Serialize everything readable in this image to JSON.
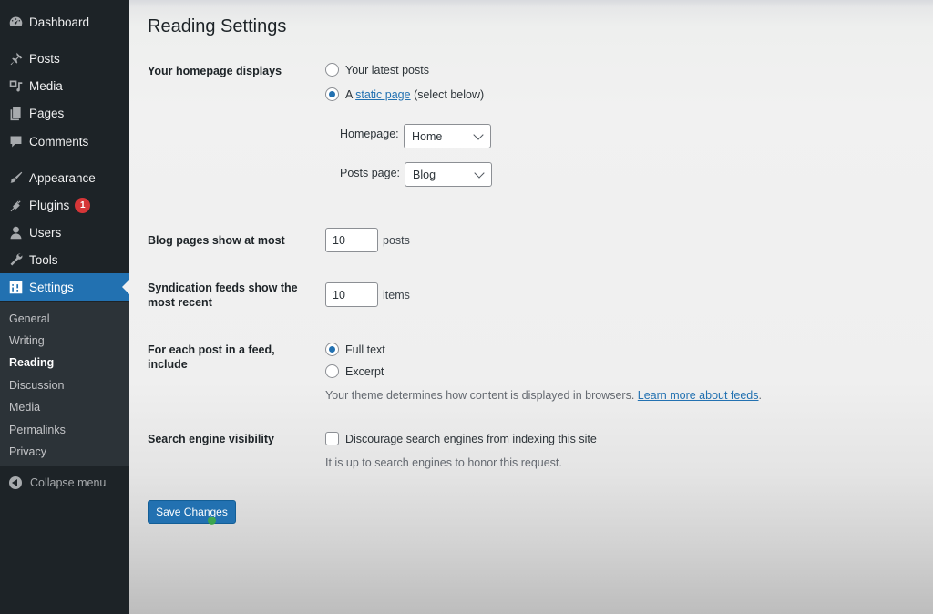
{
  "sidebar": {
    "items": [
      {
        "label": "Dashboard",
        "icon": "dashboard-icon"
      },
      {
        "label": "Posts",
        "icon": "pin-icon"
      },
      {
        "label": "Media",
        "icon": "media-icon"
      },
      {
        "label": "Pages",
        "icon": "pages-icon"
      },
      {
        "label": "Comments",
        "icon": "comment-icon"
      },
      {
        "label": "Appearance",
        "icon": "brush-icon"
      },
      {
        "label": "Plugins",
        "icon": "plugin-icon",
        "badge": "1"
      },
      {
        "label": "Users",
        "icon": "user-icon"
      },
      {
        "label": "Tools",
        "icon": "wrench-icon"
      },
      {
        "label": "Settings",
        "icon": "settings-icon",
        "active": true
      }
    ],
    "submenu": [
      {
        "label": "General"
      },
      {
        "label": "Writing"
      },
      {
        "label": "Reading",
        "current": true
      },
      {
        "label": "Discussion"
      },
      {
        "label": "Media"
      },
      {
        "label": "Permalinks"
      },
      {
        "label": "Privacy"
      }
    ],
    "collapse_label": "Collapse menu"
  },
  "page": {
    "title": "Reading Settings",
    "homepage_displays": {
      "label": "Your homepage displays",
      "options": [
        {
          "label": "Your latest posts",
          "checked": false
        },
        {
          "prefix": "A ",
          "link": "static page",
          "suffix": " (select below)",
          "checked": true
        }
      ],
      "homepage_select": {
        "label": "Homepage:",
        "value": "Home"
      },
      "posts_page_select": {
        "label": "Posts page:",
        "value": "Blog"
      }
    },
    "blog_pages": {
      "label": "Blog pages show at most",
      "value": "10",
      "unit": "posts"
    },
    "syndication": {
      "label": "Syndication feeds show the most recent",
      "value": "10",
      "unit": "items"
    },
    "feed_include": {
      "label": "For each post in a feed, include",
      "options": [
        {
          "label": "Full text",
          "checked": true
        },
        {
          "label": "Excerpt",
          "checked": false
        }
      ],
      "description": "Your theme determines how content is displayed in browsers. ",
      "link": "Learn more about feeds",
      "suffix": "."
    },
    "search_visibility": {
      "label": "Search engine visibility",
      "checkbox_label": "Discourage search engines from indexing this site",
      "checked": false,
      "description": "It is up to search engines to honor this request."
    },
    "save_label": "Save Changes"
  },
  "colors": {
    "sidebar_bg": "#1d2327",
    "accent": "#2271b1",
    "badge": "#d63638"
  }
}
